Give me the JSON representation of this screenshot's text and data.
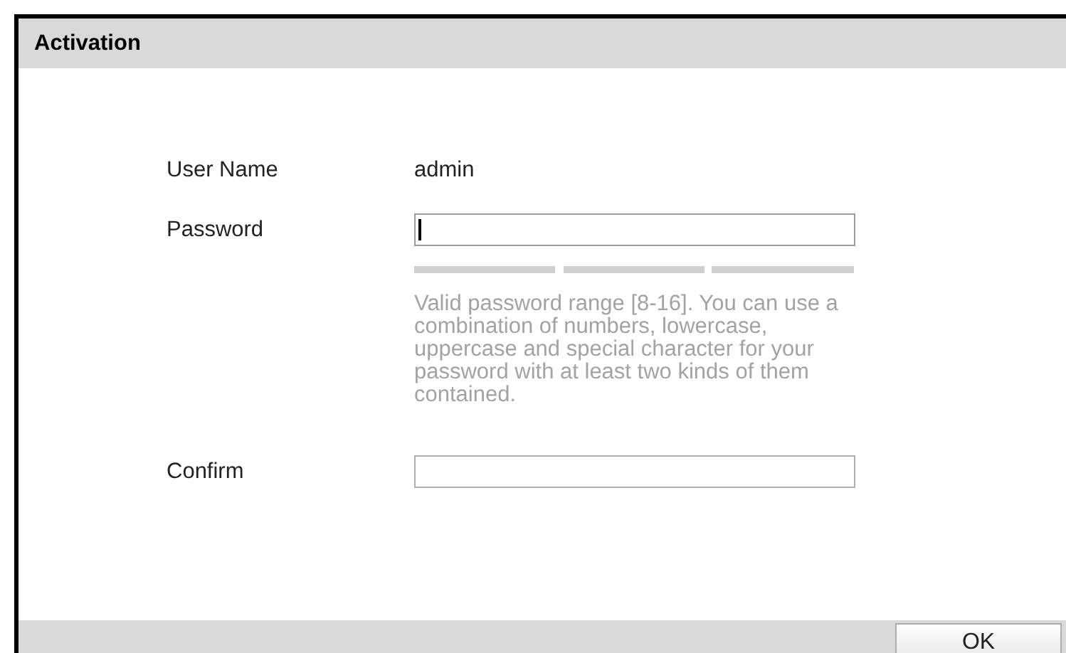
{
  "dialog": {
    "title": "Activation"
  },
  "fields": [
    {
      "kind": "text",
      "label": "User Name",
      "value": "admin"
    },
    {
      "kind": "input",
      "label": "Password",
      "focused": true,
      "strength_meter": true,
      "hint": "Valid password range [8-16]. You can use a combination of numbers, lowercase, uppercase and special character for your password with at least two kinds of them contained."
    },
    {
      "kind": "input",
      "label": "Confirm",
      "focused": false
    }
  ],
  "buttons": [
    "OK"
  ]
}
